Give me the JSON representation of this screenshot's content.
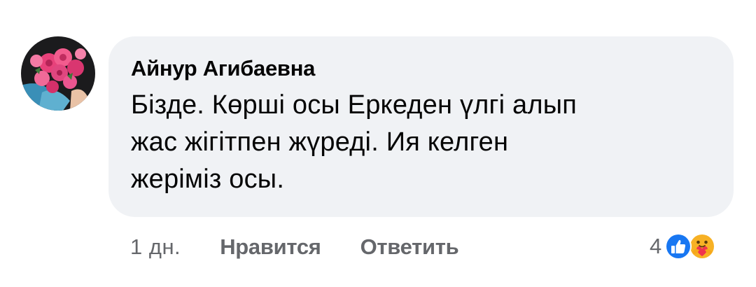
{
  "comment": {
    "author": "Айнур Агибаевна",
    "text_lines": [
      "Бізде. Көрші осы Еркеден үлгі алып",
      "жас жігітпен жүреді. Ия келген",
      "жеріміз осы."
    ],
    "avatar_icon": "profile-photo-pink-roses"
  },
  "actions": {
    "time": "1 дн.",
    "like_label": "Нравится",
    "reply_label": "Ответить"
  },
  "reactions": {
    "count": "4",
    "icons": [
      "like-icon",
      "care-icon"
    ],
    "like_color": "#1877f2",
    "care_color": "#f7b125"
  },
  "colors": {
    "bubble_bg": "#f0f2f5",
    "text": "#050505",
    "secondary_text": "#65676b"
  }
}
